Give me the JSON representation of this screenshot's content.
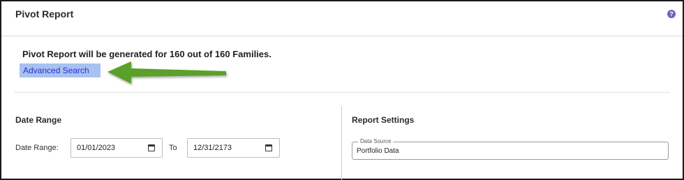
{
  "header": {
    "title": "Pivot Report",
    "help_icon": "question-circle-icon",
    "help_glyph": "?"
  },
  "summary": {
    "text": "Pivot Report will be generated for 160 out of 160 Families.",
    "advanced_search_label": "Advanced Search"
  },
  "annotation": {
    "arrow_icon": "green-arrow-left-icon",
    "arrow_color": "#5aa02c"
  },
  "date_range": {
    "section_title": "Date Range",
    "field_label": "Date Range:",
    "from_value": "01/01/2023",
    "to_label": "To",
    "to_value": "12/31/2173"
  },
  "report_settings": {
    "section_title": "Report Settings",
    "data_source_label": "Data Source",
    "data_source_value": "Portfolio Data"
  },
  "colors": {
    "link_highlight": "#a9c1f0",
    "link_text": "#2533d6",
    "help_icon": "#6f63b8"
  }
}
